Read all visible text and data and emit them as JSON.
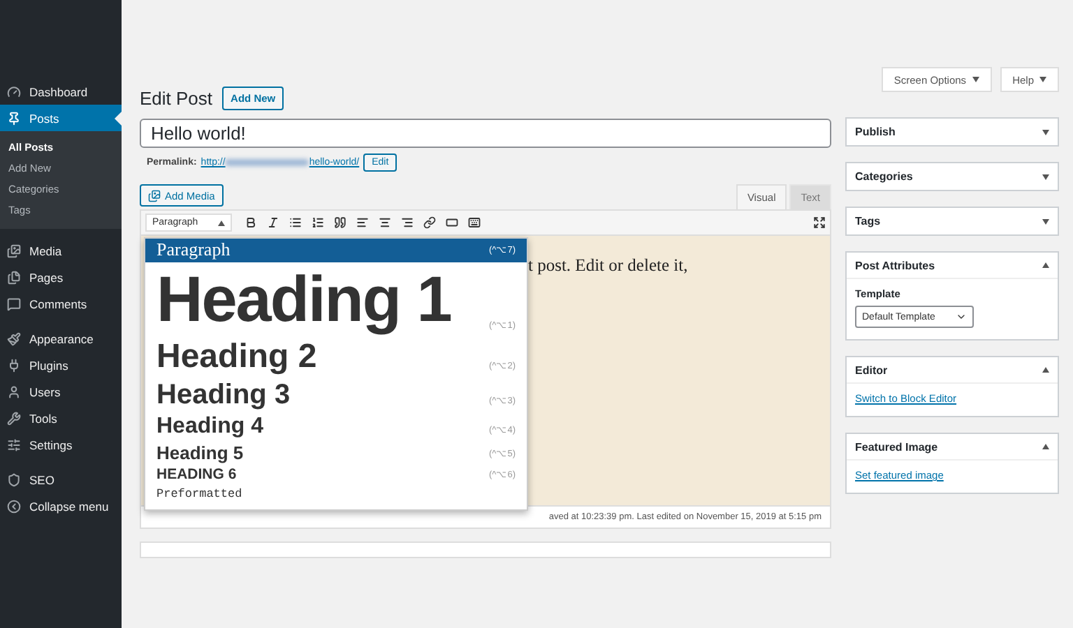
{
  "sidebar": {
    "items": [
      {
        "label": "Dashboard",
        "selected": false
      },
      {
        "label": "Posts",
        "selected": true,
        "children": [
          {
            "label": "All Posts",
            "selected": true
          },
          {
            "label": "Add New",
            "selected": false
          },
          {
            "label": "Categories",
            "selected": false
          },
          {
            "label": "Tags",
            "selected": false
          }
        ]
      },
      {
        "label": "Media",
        "selected": false
      },
      {
        "label": "Pages",
        "selected": false
      },
      {
        "label": "Comments",
        "selected": false
      },
      {
        "label": "Appearance",
        "selected": false
      },
      {
        "label": "Plugins",
        "selected": false
      },
      {
        "label": "Users",
        "selected": false
      },
      {
        "label": "Tools",
        "selected": false
      },
      {
        "label": "Settings",
        "selected": false
      },
      {
        "label": "SEO",
        "selected": false
      },
      {
        "label": "Collapse menu",
        "selected": false
      }
    ]
  },
  "top_buttons": [
    "Screen Options",
    "Help"
  ],
  "page_title": "Edit Post",
  "add_new": "Add New",
  "post_title": "Hello world!",
  "permalink": {
    "label": "Permalink:",
    "url_start": "http://",
    "url_end": "hello-world/",
    "edit": "Edit"
  },
  "add_media": "Add Media",
  "editor_tabs": [
    {
      "label": "Visual",
      "selected": true
    },
    {
      "label": "Text",
      "selected": false
    }
  ],
  "format_select": "Paragraph",
  "format_menu": [
    {
      "kind": "p",
      "label": "Paragraph",
      "shortcut": "(^⌥7)",
      "selected": true
    },
    {
      "kind": "h1",
      "label": "Heading 1",
      "shortcut": "(^⌥1)",
      "selected": false
    },
    {
      "kind": "h2",
      "label": "Heading 2",
      "shortcut": "(^⌥2)",
      "selected": false
    },
    {
      "kind": "h3",
      "label": "Heading 3",
      "shortcut": "(^⌥3)",
      "selected": false
    },
    {
      "kind": "h4",
      "label": "Heading 4",
      "shortcut": "(^⌥4)",
      "selected": false
    },
    {
      "kind": "h5",
      "label": "Heading 5",
      "shortcut": "(^⌥5)",
      "selected": false
    },
    {
      "kind": "h6",
      "label": "HEADING 6",
      "shortcut": "(^⌥6)",
      "selected": false
    },
    {
      "kind": "pre",
      "label": "Preformatted",
      "selected": false
    }
  ],
  "editor_text": "t post. Edit or delete it,",
  "status_text": "aved at 10:23:39 pm. Last edited on November 15, 2019 at 5:15 pm",
  "panels": [
    {
      "title": "Publish",
      "expanded": false
    },
    {
      "title": "Categories",
      "expanded": false
    },
    {
      "title": "Tags",
      "expanded": false
    },
    {
      "kind": "select",
      "title": "Post Attributes",
      "expanded": true,
      "label": "Template",
      "value": "Default Template"
    },
    {
      "kind": "link",
      "title": "Editor",
      "expanded": true,
      "link": "Switch to Block Editor"
    },
    {
      "kind": "link",
      "title": "Featured Image",
      "expanded": true,
      "link": "Set featured image"
    }
  ]
}
